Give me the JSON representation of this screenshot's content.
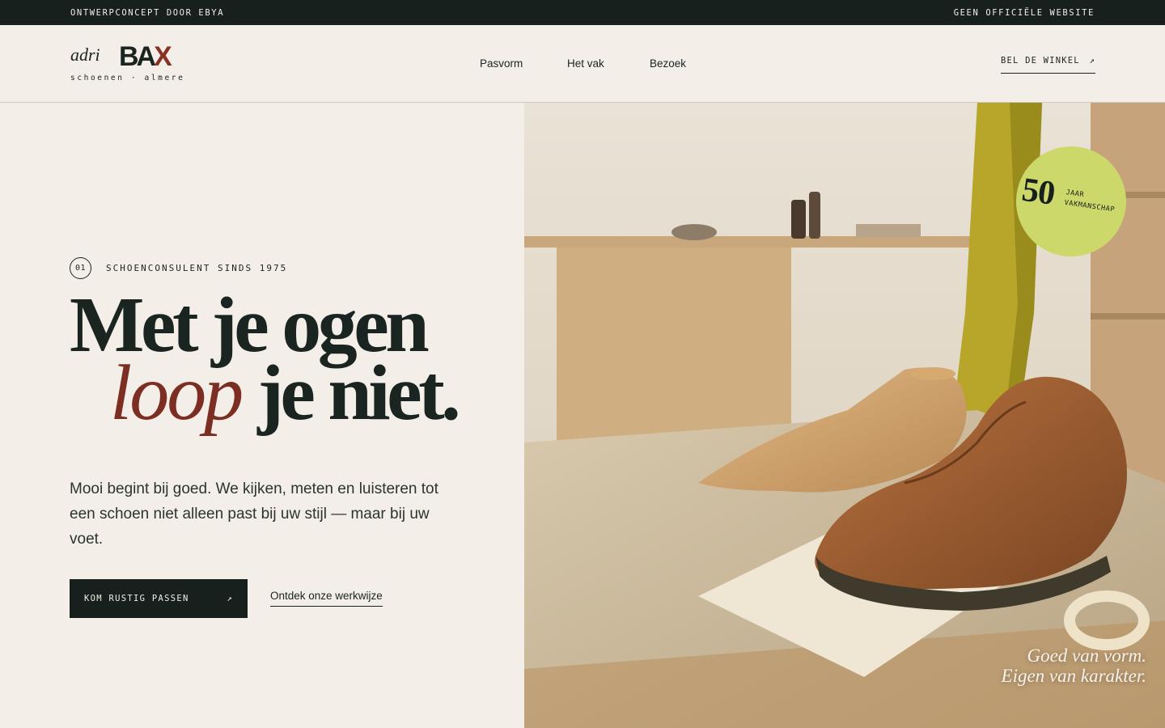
{
  "topbar": {
    "left": "ONTWERPCONCEPT DOOR EBYA",
    "right": "GEEN OFFICIËLE WEBSITE"
  },
  "logo": {
    "script": "adri",
    "brand_main": "BA",
    "brand_accent": "X",
    "tagline": "schoenen · almere"
  },
  "nav": {
    "items": [
      "Pasvorm",
      "Het vak",
      "Bezoek"
    ]
  },
  "call_button": {
    "label": "BEL DE WINKEL",
    "icon": "arrow-up-right-icon",
    "glyph": "↗"
  },
  "hero": {
    "eyebrow_number": "01",
    "eyebrow_text": "SCHOENCONSULENT SINDS 1975",
    "headline_line1": "Met je ogen",
    "headline_accent": "loop",
    "headline_line2_rest": "je niet.",
    "lead": "Mooi begint bij goed. We kijken, meten en luisteren tot een schoen niet alleen past bij uw stijl — maar bij uw voet.",
    "cta_label": "KOM RUSTIG PASSEN",
    "cta_glyph": "↗",
    "secondary_link": "Ontdek onze werkwijze"
  },
  "badge": {
    "number": "50",
    "line1": "JAAR",
    "line2": "VAKMANSCHAP"
  },
  "image_caption": {
    "line1": "Goed van vorm.",
    "line2": "Eigen van karakter."
  },
  "colors": {
    "background": "#f3eee7",
    "dark": "#17201d",
    "accent": "#7c2e22",
    "badge": "#ccd86a"
  }
}
